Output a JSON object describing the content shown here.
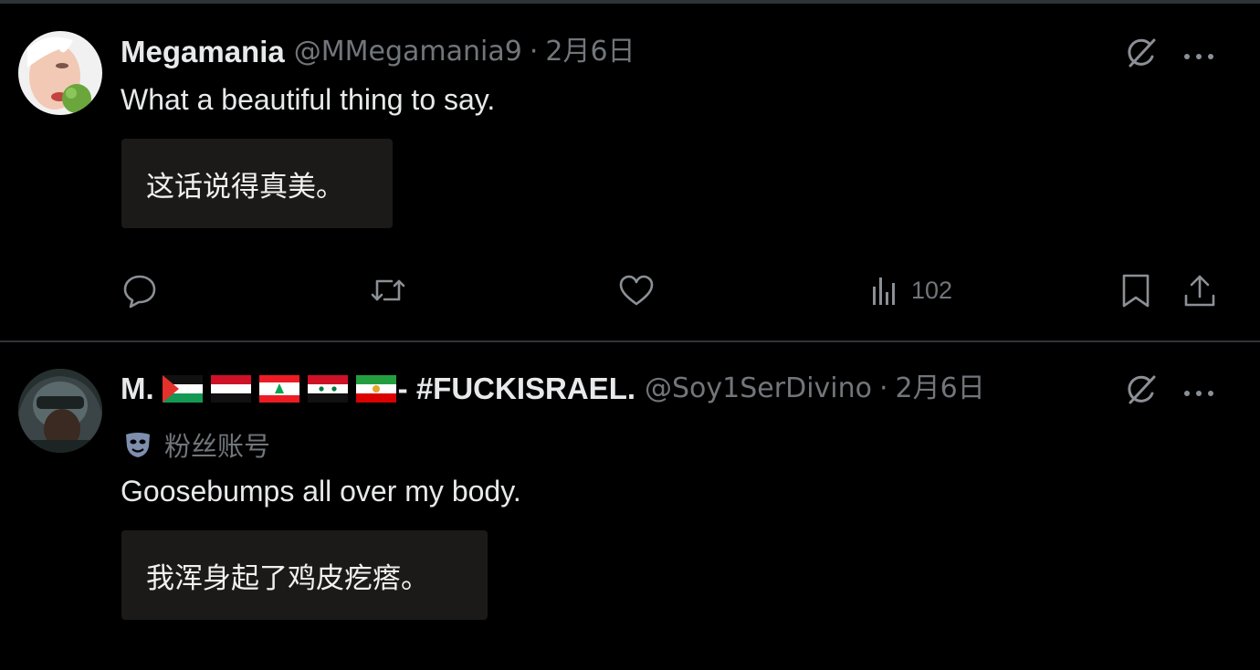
{
  "tweets": [
    {
      "display_name": "Megamania",
      "handle": "@MMegamania9",
      "separator": "·",
      "date": "2月6日",
      "text": "What a beautiful thing to say.",
      "translation": "这话说得真美。",
      "views": "102"
    },
    {
      "display_name": "M.",
      "name_suffix": "- #FUCKISRAEL.",
      "flags": [
        "palestine-flag",
        "yemen-flag",
        "lebanon-flag",
        "syria-flag",
        "iran-flag"
      ],
      "handle": "@Soy1SerDivino",
      "separator": "·",
      "date": "2月6日",
      "badge_label": "粉丝账号",
      "text": "Goosebumps all over my body.",
      "translation": "我浑身起了鸡皮疙瘩。"
    }
  ],
  "icons": [
    "grok-icon",
    "more-icon",
    "reply-icon",
    "retweet-icon",
    "like-icon",
    "views-icon",
    "bookmark-icon",
    "share-icon",
    "mask-icon"
  ],
  "colors": {
    "background": "#000000",
    "text": "#e7e9ea",
    "secondary": "#71767b",
    "translation_bg": "#1c1a19",
    "divider": "#2f3336"
  }
}
